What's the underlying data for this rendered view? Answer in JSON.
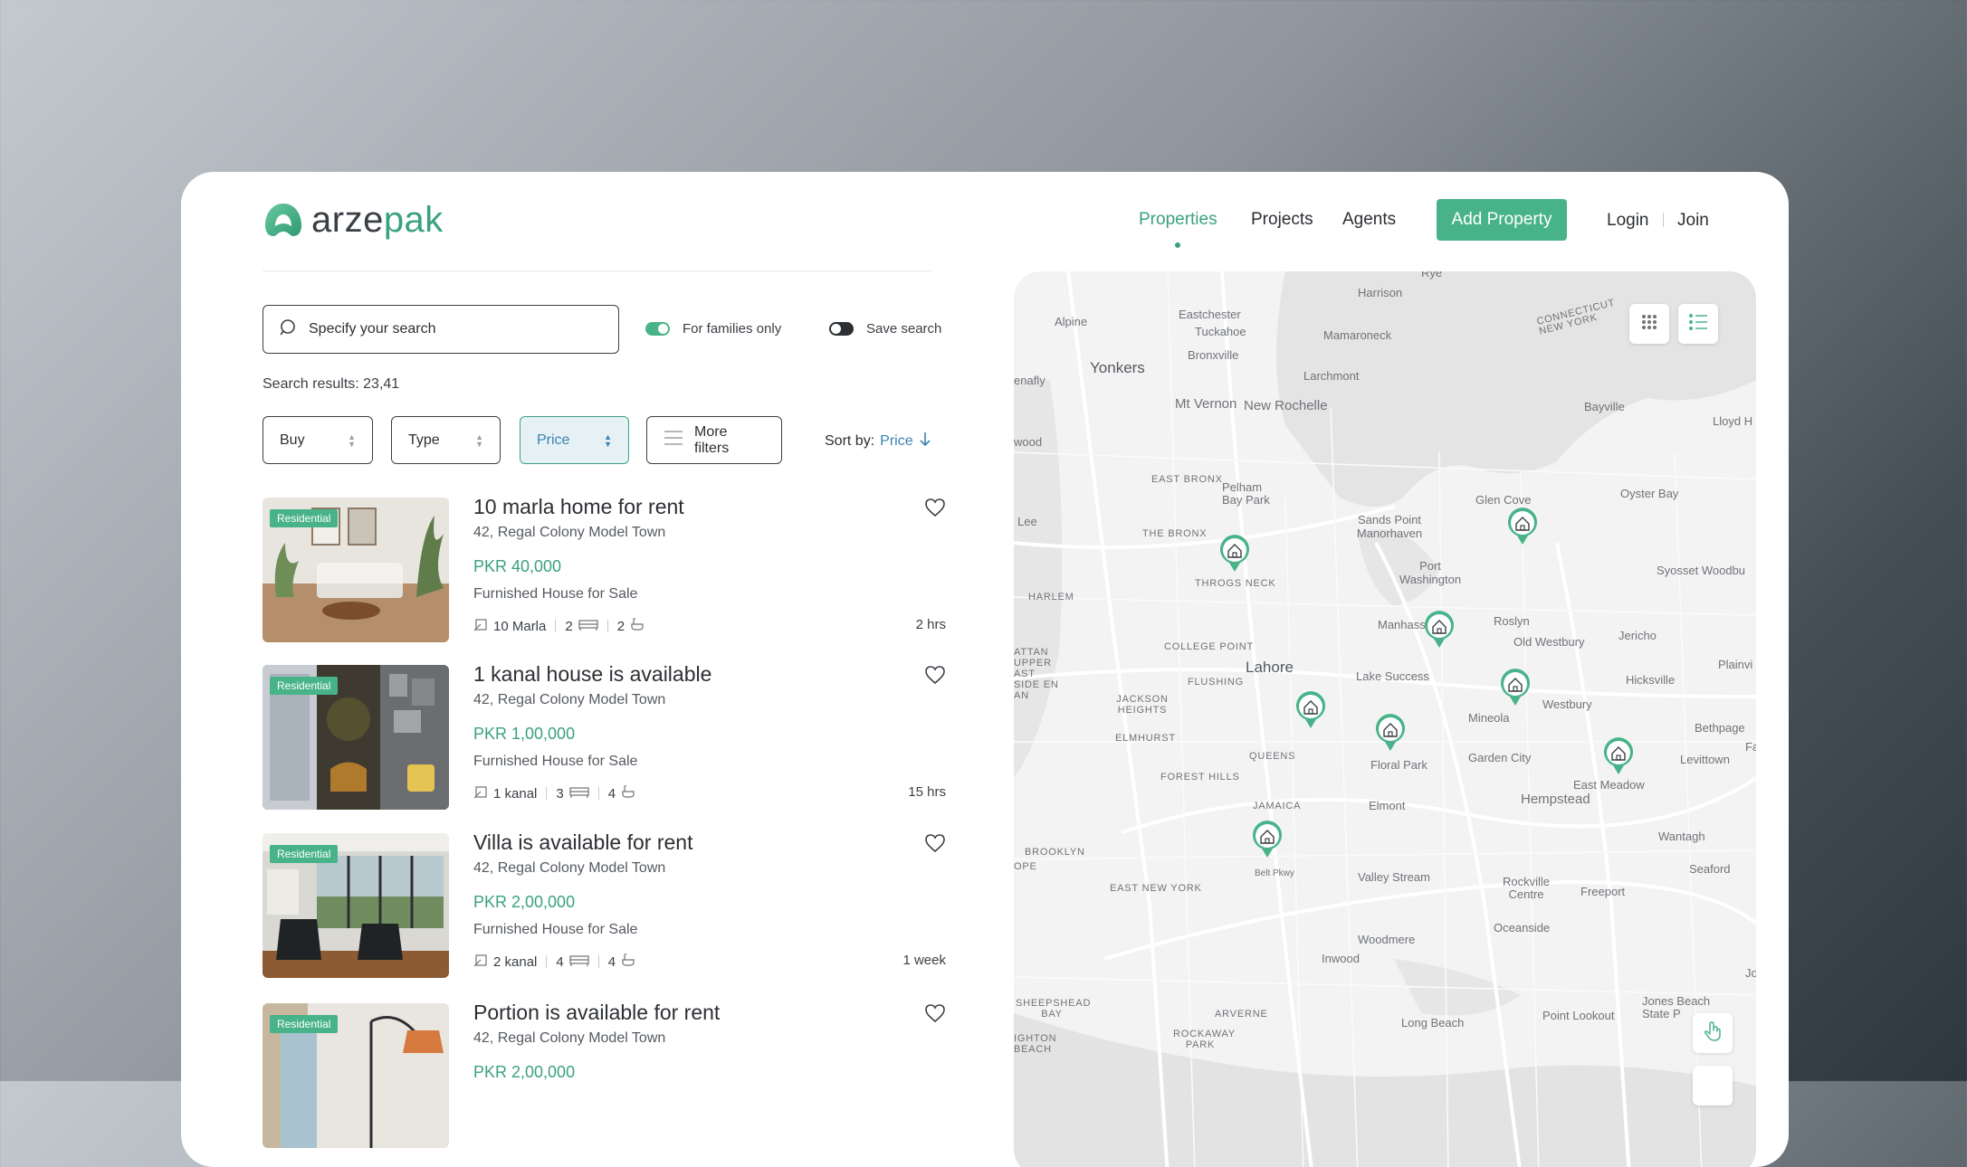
{
  "brand": {
    "name_part1": "arze",
    "name_part2": "pak",
    "accent": "#48b389",
    "link_blue": "#3a82b0"
  },
  "nav": {
    "items": [
      {
        "label": "Properties",
        "active": true
      },
      {
        "label": "Projects"
      },
      {
        "label": "Agents"
      }
    ],
    "add_property": "Add Property",
    "login": "Login",
    "join": "Join"
  },
  "search": {
    "placeholder": "Specify your search",
    "families_label": "For families only",
    "families_on": true,
    "save_label": "Save search",
    "save_on": false,
    "results": "Search results: 23,41"
  },
  "filters": {
    "buy": "Buy",
    "type": "Type",
    "price": "Price",
    "more": "More filters",
    "sort_label": "Sort by:",
    "sort_value": "Price"
  },
  "listings": [
    {
      "badge": "Residential",
      "title": "10 marla home for rent",
      "address": "42, Regal Colony Model Town",
      "price": "PKR 40,000",
      "desc": "Furnished House for Sale",
      "area": "10 Marla",
      "beds": "2",
      "baths": "2",
      "time": "2 hrs"
    },
    {
      "badge": "Residential",
      "title": "1 kanal house is available",
      "address": "42, Regal Colony Model Town",
      "price": "PKR 1,00,000",
      "desc": "Furnished House for Sale",
      "area": "1 kanal",
      "beds": "3",
      "baths": "4",
      "time": "15 hrs"
    },
    {
      "badge": "Residential",
      "title": "Villa is available for rent",
      "address": "42, Regal Colony Model Town",
      "price": "PKR 2,00,000",
      "desc": "Furnished House for Sale",
      "area": "2 kanal",
      "beds": "4",
      "baths": "4",
      "time": "1 week"
    },
    {
      "badge": "Residential",
      "title": "Portion is available for rent",
      "address": "42, Regal Colony Model Town",
      "price": "PKR 2,00,000"
    }
  ],
  "map": {
    "labels": {
      "rye": "Rye",
      "harrison": "Harrison",
      "eastchester": "Eastchester",
      "alpine": "Alpine",
      "tuckahoe": "Tuckahoe",
      "mamaroneck": "Mamaroneck",
      "ct_ny": "CONNECTICUT NEW YORK",
      "bronxville": "Bronxville",
      "yonkers": "Yonkers",
      "larchmont": "Larchmont",
      "enafly": "enafly",
      "mt_vernon": "Mt Vernon",
      "new_rochelle": "New Rochelle",
      "bayville": "Bayville",
      "lloyd": "Lloyd H",
      "wood": "wood",
      "east_bronx": "EAST BRONX",
      "pelham": "Pelham Bay Park",
      "oyster_bay": "Oyster Bay",
      "glen_cove": "Glen Cove",
      "lee": "Lee",
      "sands_point": "Sands Point Manorhaven",
      "the_bronx": "THE BRONX",
      "port_wash": "Port Washington",
      "throgs": "THROGS NECK",
      "syosset": "Syosset Woodbu",
      "harlem": "HARLEM",
      "manhasset": "Manhass",
      "roslyn": "Roslyn",
      "jericho": "Jericho",
      "college_point": "COLLEGE POINT",
      "old_westbury": "Old Westbury",
      "manhattan": "ATTAN UPPER AST SIDE EN AN",
      "lahore": "Lahore",
      "lake_success": "Lake Success",
      "hicksville": "Hicksville",
      "plainview": "Plainvi",
      "flushing": "FLUSHING",
      "jackson": "JACKSON HEIGHTS",
      "westbury": "Westbury",
      "mineola": "Mineola",
      "bethpage": "Bethpage",
      "elmhurst": "ELMHURST",
      "queens": "QUEENS",
      "garden_city": "Garden City",
      "levittown": "Levittown",
      "floral_park": "Floral Park",
      "forest_hills": "FOREST HILLS",
      "east_meadow": "East Meadow",
      "hempstead": "Hempstead",
      "jamaica": "JAMAICA",
      "elmont": "Elmont",
      "wantagh": "Wantagh",
      "brooklyn": "BROOKLYN",
      "ope": "OPE",
      "seaford": "Seaford",
      "valley_stream": "Valley Stream",
      "rockville": "Rockville Centre",
      "freeport": "Freeport",
      "east_ny": "EAST NEW YORK",
      "belt_pkwy": "Belt Pkwy",
      "oceanside": "Oceanside",
      "woodmere": "Woodmere",
      "inwood": "Inwood",
      "jones_beach": "Jones Beach State P",
      "sheepshead": "SHEEPSHEAD BAY",
      "arverne": "ARVERNE",
      "point_lookout": "Point Lookout",
      "long_beach": "Long Beach",
      "rockaway": "ROCKAWAY PARK",
      "brighton": "IGHTON BEACH",
      "jor": "Jor",
      "fa": "Fa"
    }
  }
}
